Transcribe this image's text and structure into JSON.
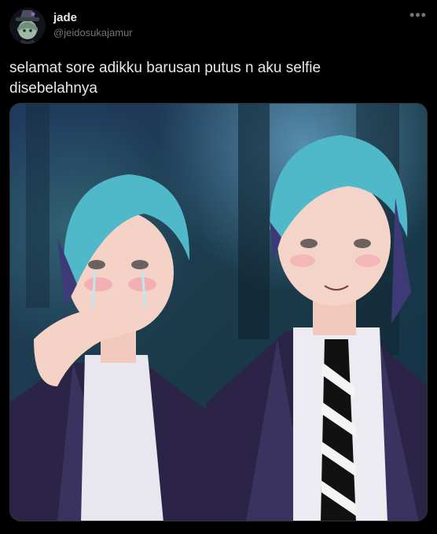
{
  "tweet": {
    "author": {
      "display_name": "jade",
      "handle": "@jeidosukajamur",
      "avatar_icon": "anime-avatar-with-hat"
    },
    "more_icon": "more-options-icon",
    "text": "selamat sore adikku barusan putus n aku selfie\ndisebelahnya",
    "media": {
      "description_icon": "anime-illustration-two-boys"
    }
  },
  "colors": {
    "background": "#000000",
    "text_primary": "#e7e9ea",
    "text_secondary": "#71767b",
    "border": "#2f3336",
    "hair": "#4fb8c9",
    "uniform": "#2b2447"
  }
}
